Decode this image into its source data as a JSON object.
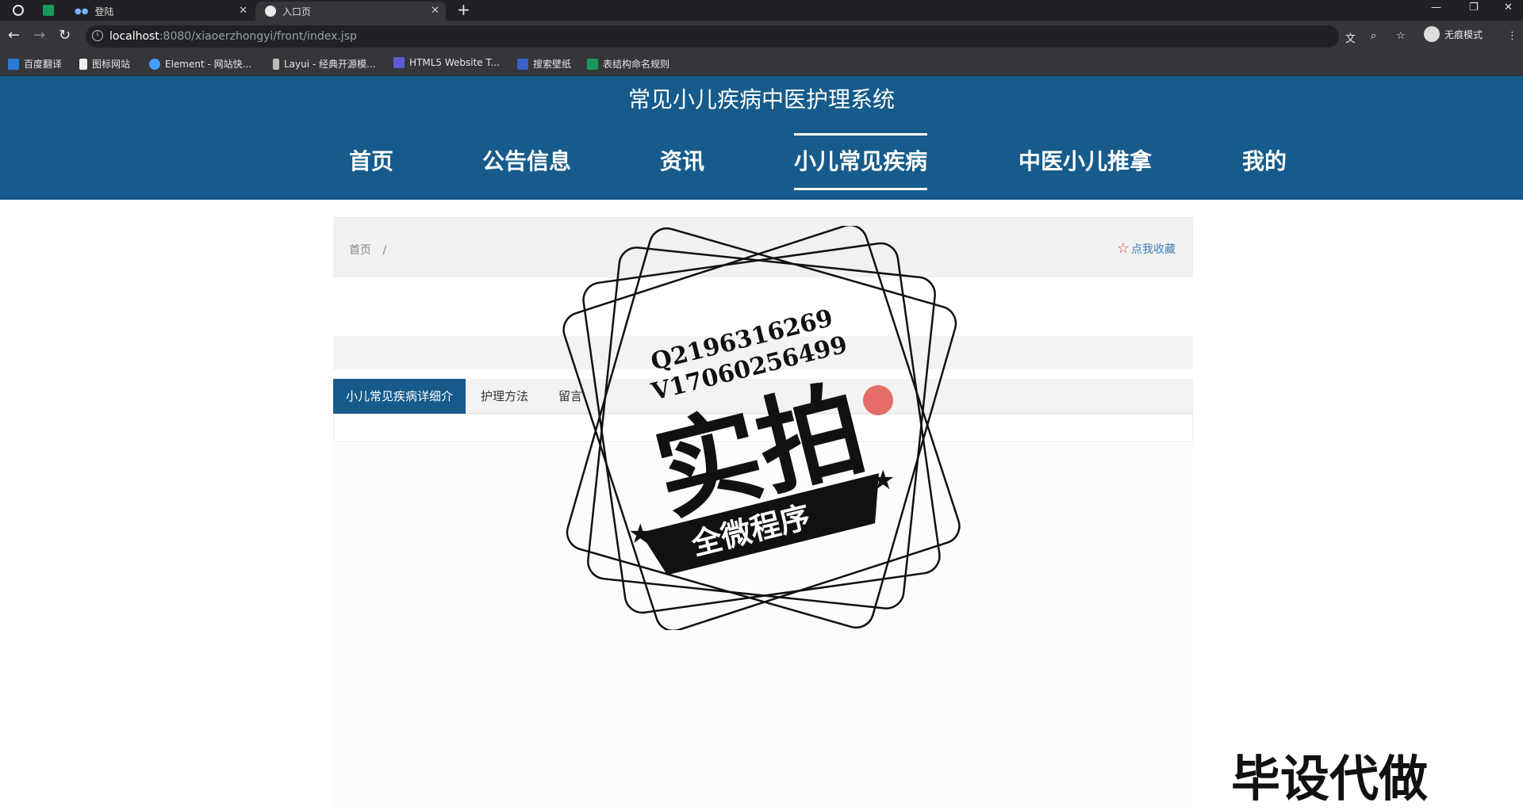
{
  "browser": {
    "tabs": [
      {
        "title": "登陆"
      },
      {
        "title": "入口页"
      }
    ],
    "url_host": "localhost",
    "url_path": ":8080/xiaoerzhongyi/front/index.jsp",
    "incognito_label": "无痕模式",
    "bookmarks": [
      {
        "label": "百度翻译",
        "color": "#2b7bd6"
      },
      {
        "label": "图标网站",
        "color": "#ffffff"
      },
      {
        "label": "Element - 网站快...",
        "color": "#409eff"
      },
      {
        "label": "Layui - 经典开源模...",
        "color": "#cccccc"
      },
      {
        "label": "HTML5 Website T...",
        "color": "#5b5bd6"
      },
      {
        "label": "搜索壁纸",
        "color": "#3a62c9"
      },
      {
        "label": "表结构命名规则",
        "color": "#1a9a5a"
      }
    ]
  },
  "site": {
    "title": "常见小儿疾病中医护理系统",
    "nav": [
      {
        "label": "首页"
      },
      {
        "label": "公告信息"
      },
      {
        "label": "资讯"
      },
      {
        "label": "小儿常见疾病",
        "active": true
      },
      {
        "label": "中医小儿推拿"
      },
      {
        "label": "我的"
      }
    ],
    "accent_color": "#165b8b"
  },
  "breadcrumb": {
    "home": "首页",
    "separator": "/"
  },
  "favorite_label": "点我收藏",
  "content_tabs": [
    {
      "label": "小儿常见疾病详细介",
      "active": true
    },
    {
      "label": "护理方法"
    },
    {
      "label": "留言"
    }
  ],
  "overlay": {
    "stamp_line1": "Q2196316269",
    "stamp_line2": "V17060256499",
    "stamp_big": "实拍",
    "stamp_banner": "全微程序",
    "watermark": "毕设代做"
  }
}
